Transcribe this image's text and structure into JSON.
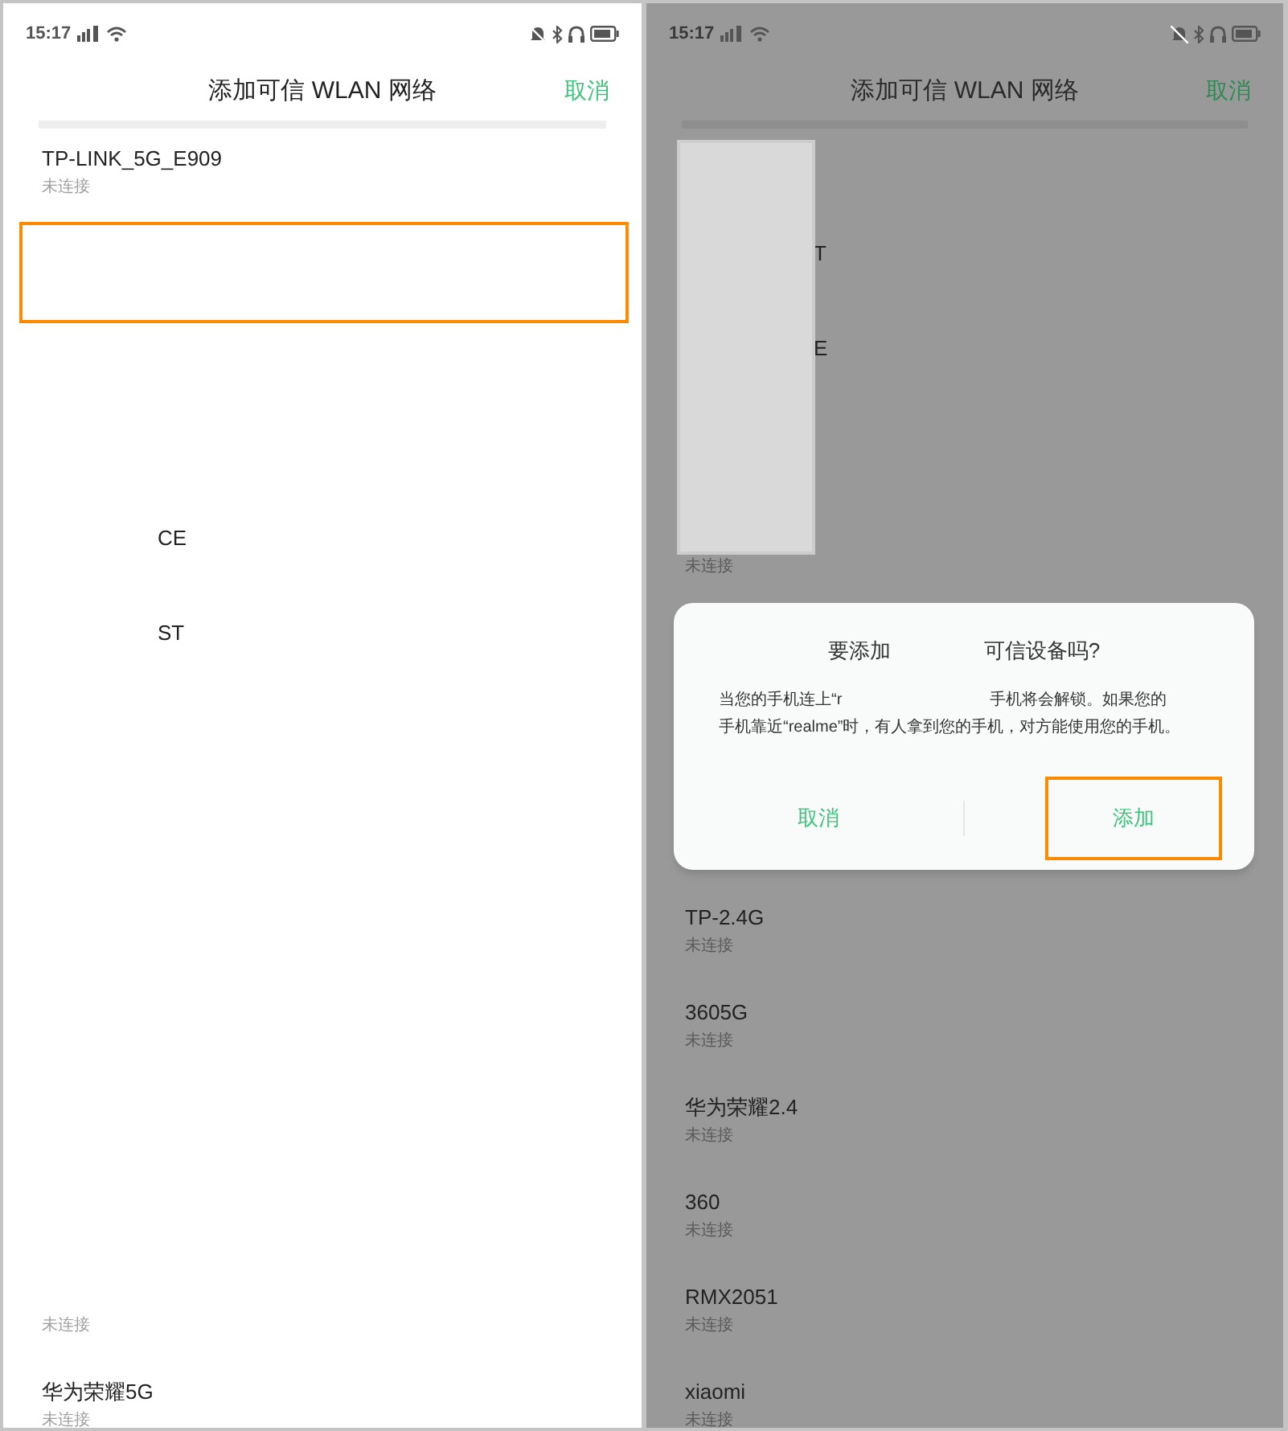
{
  "screens": [
    {
      "dimmed": false,
      "status_bar": {
        "time": "15:17"
      },
      "header": {
        "title": "添加可信 WLAN 网络",
        "cancel": "取消"
      },
      "networks": [
        {
          "kind": "full",
          "name": "TP-LINK_5G_E909",
          "status": "未连接"
        },
        {
          "kind": "blank",
          "highlighted": true
        },
        {
          "kind": "blank"
        },
        {
          "kind": "blank"
        },
        {
          "kind": "fragment",
          "name": "CE"
        },
        {
          "kind": "fragment",
          "name": "ST"
        },
        {
          "kind": "blank"
        },
        {
          "kind": "blank"
        },
        {
          "kind": "blank"
        },
        {
          "kind": "blank"
        },
        {
          "kind": "blank"
        },
        {
          "kind": "blank"
        },
        {
          "kind": "full",
          "status": "未连接"
        },
        {
          "kind": "full",
          "name": "华为荣耀5G",
          "status": "未连接"
        }
      ]
    },
    {
      "dimmed": true,
      "status_bar": {
        "time": "15:17"
      },
      "header": {
        "title": "添加可信 WLAN 网络",
        "cancel": "取消"
      },
      "redaction": true,
      "networks": [
        {
          "kind": "blank"
        },
        {
          "kind": "fragment",
          "name": "T"
        },
        {
          "kind": "fragment",
          "name": "E"
        },
        {
          "kind": "blank"
        },
        {
          "kind": "full",
          "status": "未连接"
        },
        {
          "kind": "blank"
        },
        {
          "kind": "blank"
        },
        {
          "kind": "blank"
        },
        {
          "kind": "full",
          "name": "TP-2.4G",
          "status": "未连接"
        },
        {
          "kind": "full",
          "name": "3605G",
          "status": "未连接"
        },
        {
          "kind": "full",
          "name": "华为荣耀2.4",
          "status": "未连接"
        },
        {
          "kind": "full",
          "name": "360",
          "status": "未连接"
        },
        {
          "kind": "full",
          "name": "RMX2051",
          "status": "未连接"
        },
        {
          "kind": "full",
          "name": "xiaomi",
          "status": "未连接"
        }
      ],
      "dialog": {
        "title_parts": [
          "要添加",
          "可信设备吗?"
        ],
        "body_parts": [
          "当您的手机连上“r",
          "手机将会解锁。如果您的",
          "手机靠近“realme”时，有人拿到您的手机，对方能使用您的手机。"
        ],
        "buttons": [
          {
            "label": "取消",
            "highlighted": false
          },
          {
            "label": "添加",
            "highlighted": true
          }
        ]
      }
    }
  ]
}
